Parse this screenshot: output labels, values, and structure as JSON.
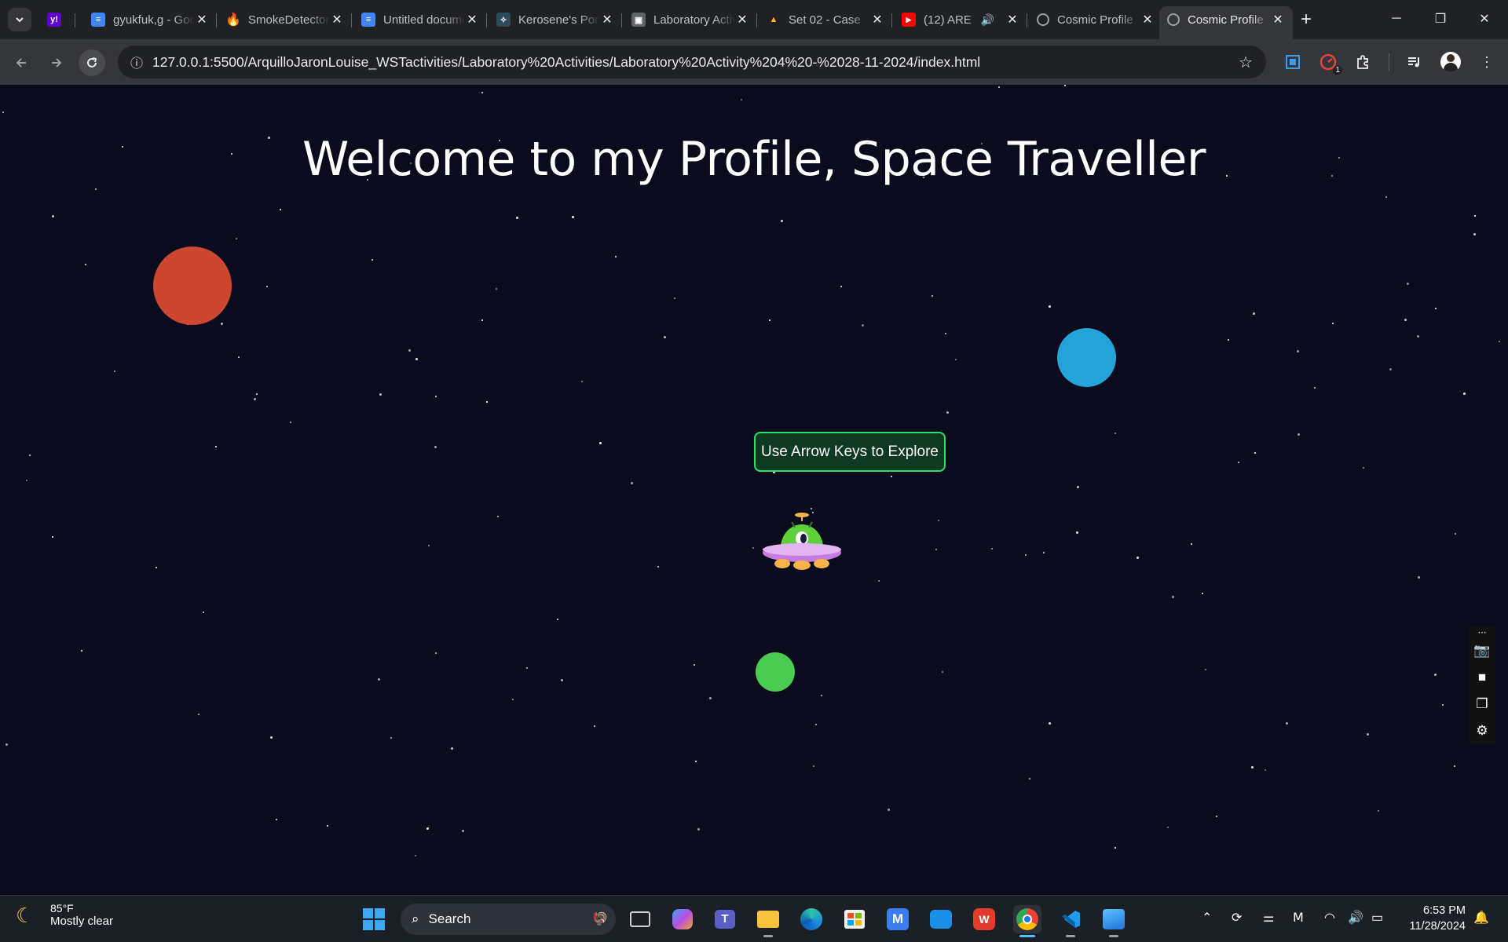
{
  "browser": {
    "tabs": [
      {
        "label": "",
        "favicon": "yahoo-icon",
        "color": "#6001d2",
        "glyph": "y!"
      },
      {
        "label": "gyukfuk,g - Google Docs",
        "favicon": "docs-icon",
        "color": "#4285f4",
        "glyph": "≡"
      },
      {
        "label": "SmokeDetector",
        "favicon": "fire-icon",
        "color": "#ff7a00",
        "glyph": "●"
      },
      {
        "label": "Untitled document",
        "favicon": "docs-icon",
        "color": "#4285f4",
        "glyph": "≡"
      },
      {
        "label": "Kerosene's Portfolio",
        "favicon": "star-outline-icon",
        "color": "#2b4a5a",
        "glyph": "✧"
      },
      {
        "label": "Laboratory Activities",
        "favicon": "classroom-icon",
        "color": "#5f6368",
        "glyph": "▣"
      },
      {
        "label": "Set 02 - Case",
        "favicon": "drive-icon",
        "color": "#34a853",
        "glyph": "▲"
      },
      {
        "label": "(12) ARE",
        "favicon": "youtube-icon",
        "color": "#ff0000",
        "glyph": "▶"
      },
      {
        "label": "Cosmic Profile",
        "favicon": "globe-icon",
        "color": "#5f6368",
        "glyph": "◍"
      },
      {
        "label": "Cosmic Profile",
        "favicon": "globe-icon",
        "color": "#5f6368",
        "glyph": "◍",
        "active": true
      }
    ],
    "url": "127.0.0.1:5500/ArquilloJaronLouise_WSTactivities/Laboratory%20Activities/Laboratory%20Activity%204%20-%2028-11-2024/index.html",
    "extension_badge": "1"
  },
  "page": {
    "title": "Welcome to my Profile, Space Traveller",
    "explore_button": "Use Arrow Keys to Explore",
    "planets": [
      {
        "name": "red",
        "color": "#cc4630"
      },
      {
        "name": "blue",
        "color": "#23a3d8"
      },
      {
        "name": "green",
        "color": "#49cc4f"
      }
    ],
    "ufo_colors": {
      "dome": "#5fcf3b",
      "saucer": "#c77de0",
      "lights": "#f8b34a"
    }
  },
  "taskbar": {
    "weather_temp": "85°F",
    "weather_text": "Mostly clear",
    "search_label": "Search",
    "time": "6:53 PM",
    "date": "11/28/2024"
  }
}
